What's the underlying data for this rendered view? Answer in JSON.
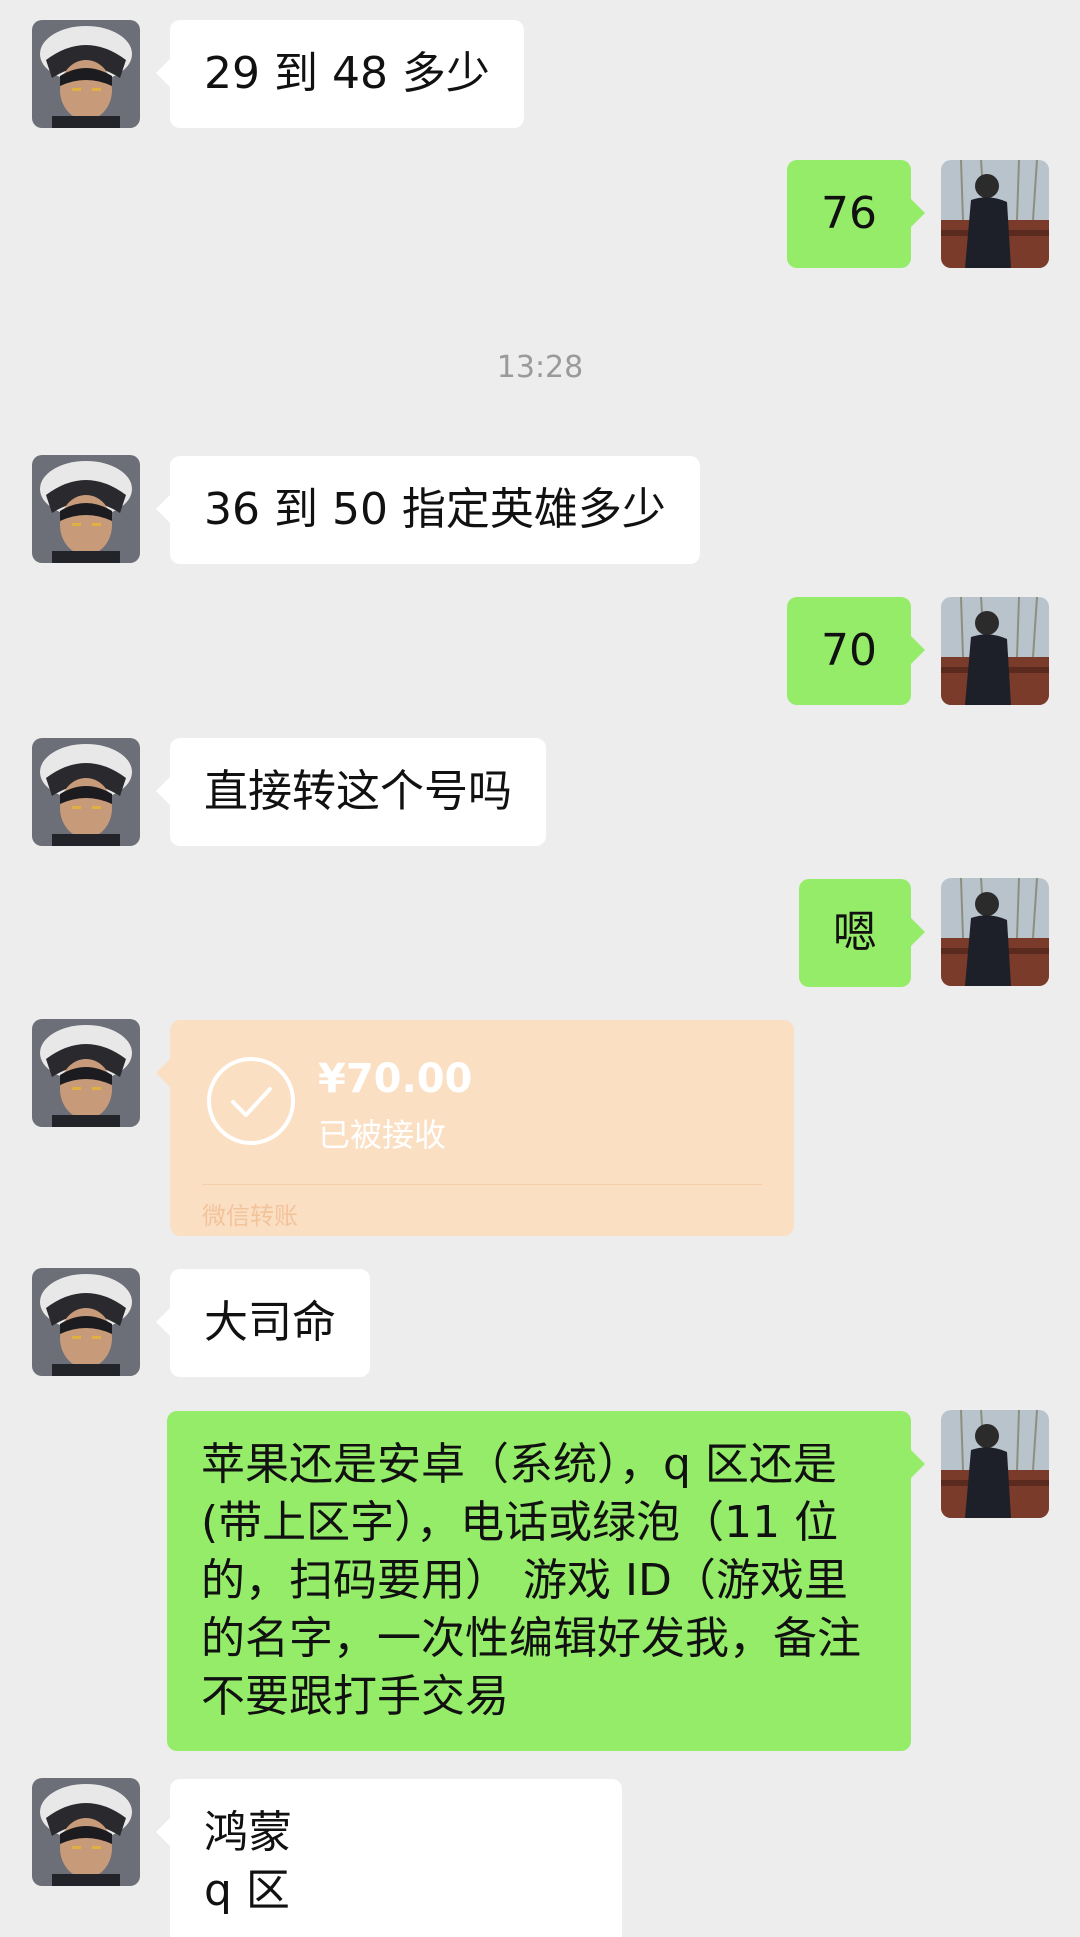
{
  "conversation": {
    "timestamp": "13:28",
    "messages": [
      {
        "side": "in",
        "text": "29 到 48 多少"
      },
      {
        "side": "out",
        "text": "76"
      },
      {
        "side": "in",
        "text": "36 到 50 指定英雄多少"
      },
      {
        "side": "out",
        "text": "70"
      },
      {
        "side": "in",
        "text": "直接转这个号吗"
      },
      {
        "side": "out",
        "text": "嗯"
      },
      {
        "side": "in",
        "text": "大司命"
      },
      {
        "side": "out",
        "lines": [
          "苹果还是安卓（系统），q 区还是",
          "(带上区字），电话或绿泡（11 位",
          "的，扫码要用） 游戏 ID（游戏里",
          "的名字，一次性编辑好发我，备注",
          "不要跟打手交易"
        ]
      },
      {
        "side": "in",
        "lines": [
          "鸿蒙",
          "q 区"
        ]
      }
    ],
    "transfer": {
      "amount": "¥70.00",
      "status": "已被接收",
      "label": "微信转账"
    }
  },
  "colors": {
    "background": "#ededed",
    "incoming_bubble": "#ffffff",
    "outgoing_bubble": "#95ec69",
    "transfer_card": "#fbdfc3",
    "timestamp": "#9a9a9a"
  },
  "icons": {
    "contact_avatar": "anime-avatar-icon",
    "user_avatar": "user-photo-avatar-icon",
    "transfer": "check-circle-icon"
  }
}
